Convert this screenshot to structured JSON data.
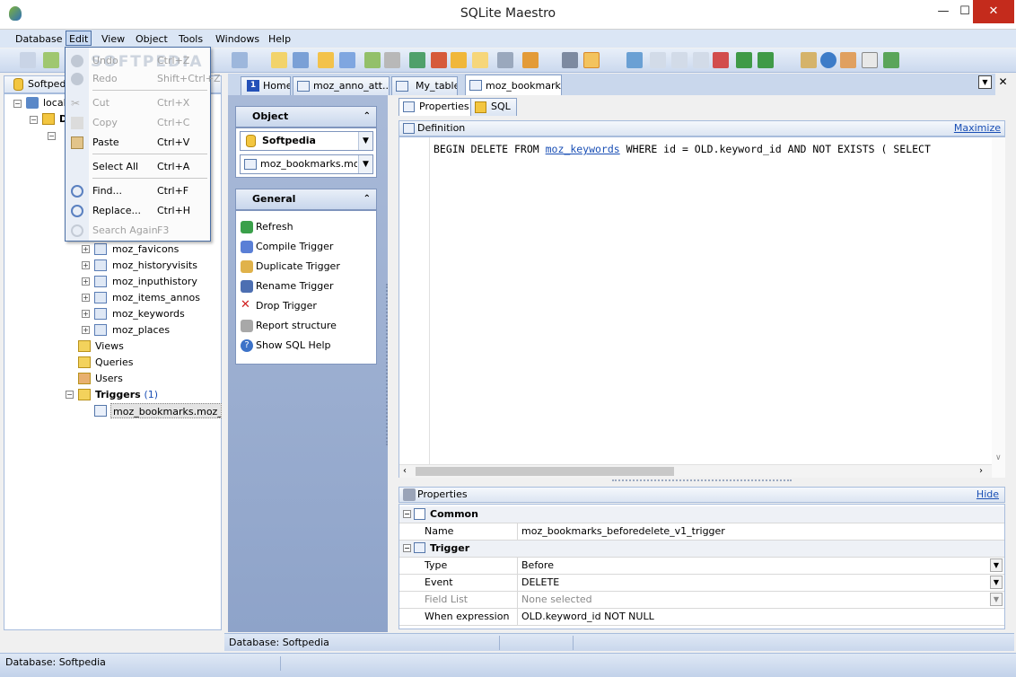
{
  "app": {
    "title": "SQLite Maestro"
  },
  "window_controls": {
    "minimize": "—",
    "maximize": "☐",
    "close": "✕"
  },
  "menubar": [
    "Database",
    "Edit",
    "View",
    "Object",
    "Tools",
    "Windows",
    "Help"
  ],
  "edit_menu": [
    {
      "label": "Undo",
      "shortcut": "Ctrl+Z",
      "enabled": false
    },
    {
      "label": "Redo",
      "shortcut": "Shift+Ctrl+Z",
      "enabled": false
    },
    {
      "label": "Cut",
      "shortcut": "Ctrl+X",
      "enabled": false
    },
    {
      "label": "Copy",
      "shortcut": "Ctrl+C",
      "enabled": false
    },
    {
      "label": "Paste",
      "shortcut": "Ctrl+V",
      "enabled": true
    },
    {
      "label": "Select All",
      "shortcut": "Ctrl+A",
      "enabled": true
    },
    {
      "label": "Find...",
      "shortcut": "Ctrl+F",
      "enabled": true
    },
    {
      "label": "Replace...",
      "shortcut": "Ctrl+H",
      "enabled": true
    },
    {
      "label": "Search Again",
      "shortcut": "F3",
      "enabled": false
    }
  ],
  "watermark": "SOFTPEDIA",
  "explorer": {
    "db_selector": "Softpedia",
    "tree": [
      {
        "label": "localh"
      },
      {
        "label": "D"
      },
      {
        "label": "moz_favicons"
      },
      {
        "label": "moz_historyvisits"
      },
      {
        "label": "moz_inputhistory"
      },
      {
        "label": "moz_items_annos"
      },
      {
        "label": "moz_keywords"
      },
      {
        "label": "moz_places"
      },
      {
        "label": "Views"
      },
      {
        "label": "Queries"
      },
      {
        "label": "Users"
      },
      {
        "label": "Triggers",
        "count": "(1)"
      },
      {
        "label": "moz_bookmarks.moz_bo"
      }
    ]
  },
  "tabs": [
    {
      "label": "Home",
      "number": "1"
    },
    {
      "label": "moz_anno_att..."
    },
    {
      "label": "My_table"
    },
    {
      "label": "moz_bookmark..."
    }
  ],
  "tab_controls": {
    "dropdown": "▼",
    "close": "✕"
  },
  "nav": {
    "object_title": "Object",
    "db_combo": "Softpedia",
    "object_combo": "moz_bookmarks.moz_",
    "general_title": "General",
    "items": [
      "Refresh",
      "Compile Trigger",
      "Duplicate Trigger",
      "Rename Trigger",
      "Drop Trigger",
      "Report structure",
      "Show SQL Help"
    ]
  },
  "editor": {
    "subtabs": [
      "Properties",
      "SQL"
    ],
    "definition_label": "Definition",
    "maximize_link": "Maximize",
    "sql_prefix": "BEGIN DELETE FROM ",
    "sql_table": "moz_keywords",
    "sql_suffix": " WHERE id = OLD.keyword_id AND NOT EXISTS ( SELECT"
  },
  "properties": {
    "title": "Properties",
    "hide_link": "Hide",
    "common": "Common",
    "name_label": "Name",
    "name_value": "moz_bookmarks_beforedelete_v1_trigger",
    "trigger": "Trigger",
    "rows": [
      {
        "label": "Type",
        "value": "Before",
        "dropdown": true,
        "dim": false
      },
      {
        "label": "Event",
        "value": "DELETE",
        "dropdown": true,
        "dim": false
      },
      {
        "label": "Field List",
        "value": "None selected",
        "dropdown": true,
        "dim": true
      },
      {
        "label": "When expression",
        "value": "OLD.keyword_id NOT NULL",
        "dropdown": false,
        "dim": false
      }
    ]
  },
  "status": {
    "inner": "Database: Softpedia",
    "main": "Database: Softpedia"
  }
}
